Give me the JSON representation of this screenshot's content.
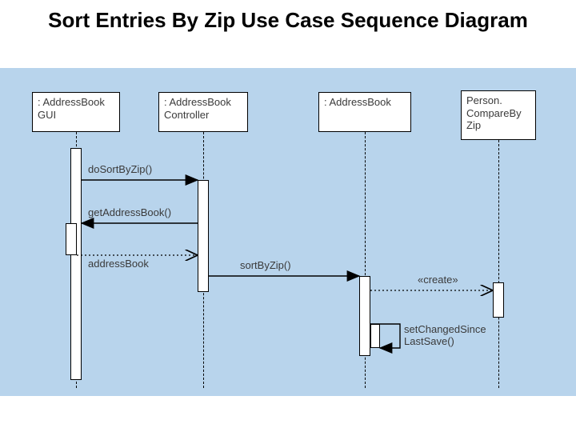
{
  "title": "Sort Entries By Zip Use Case Sequence Diagram",
  "objects": {
    "gui": ": AddressBook\nGUI",
    "controller": ": AddressBook\nController",
    "ab": ": AddressBook",
    "comparator": "Person.\nCompareBy\nZip"
  },
  "messages": {
    "doSort": "doSortByZip()",
    "getAB": "getAddressBook()",
    "retAB": "addressBook",
    "sortByZip": "sortByZip()",
    "create": "«create»",
    "setChanged": "setChangedSince\nLastSave()"
  },
  "chart_data": {
    "type": "sequence-diagram",
    "title": "Sort Entries By Zip Use Case Sequence Diagram",
    "participants": [
      {
        "id": "gui",
        "label": ": AddressBook GUI"
      },
      {
        "id": "controller",
        "label": ": AddressBook Controller"
      },
      {
        "id": "ab",
        "label": ": AddressBook"
      },
      {
        "id": "comparator",
        "label": "Person.CompareByZip"
      }
    ],
    "messages": [
      {
        "from": "gui",
        "to": "controller",
        "label": "doSortByZip()",
        "kind": "call"
      },
      {
        "from": "controller",
        "to": "gui",
        "label": "getAddressBook()",
        "kind": "call"
      },
      {
        "from": "gui",
        "to": "controller",
        "label": "addressBook",
        "kind": "return"
      },
      {
        "from": "controller",
        "to": "ab",
        "label": "sortByZip()",
        "kind": "call"
      },
      {
        "from": "ab",
        "to": "comparator",
        "label": "«create»",
        "kind": "create"
      },
      {
        "from": "ab",
        "to": "ab",
        "label": "setChangedSinceLastSave()",
        "kind": "self"
      }
    ]
  }
}
